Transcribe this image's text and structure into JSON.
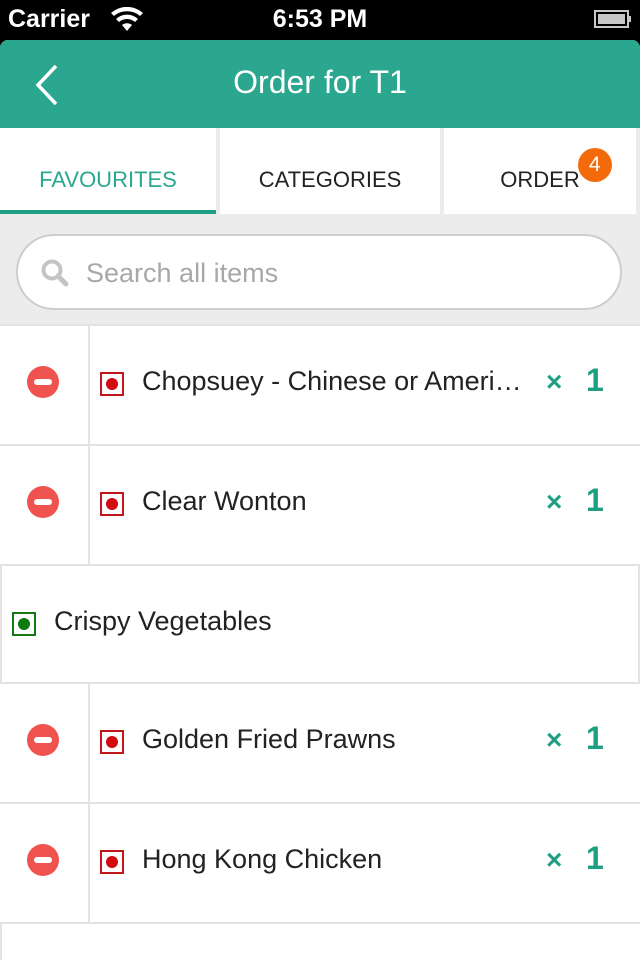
{
  "status_bar": {
    "carrier": "Carrier",
    "time": "6:53 PM",
    "wifi_icon": "wifi-icon",
    "battery_icon": "battery-icon"
  },
  "navbar": {
    "title": "Order for T1",
    "back_icon": "chevron-left-icon"
  },
  "tabs": [
    {
      "label": "FAVOURITES",
      "active": true
    },
    {
      "label": "CATEGORIES",
      "active": false
    },
    {
      "label": "ORDER",
      "active": false,
      "badge": "4"
    }
  ],
  "search": {
    "placeholder": "Search all items",
    "value": "",
    "icon": "search-icon"
  },
  "colors": {
    "accent": "#2aa78e",
    "badge": "#f36a0a",
    "remove": "#ef5350",
    "nonveg": "#d10a0f",
    "veg": "#0c7c0c"
  },
  "items": [
    {
      "name": "Chopsuey - Chinese or American",
      "display_name": "Chopsuey - Chinese or Ameri…",
      "type": "nonveg",
      "in_order": true,
      "times": "×",
      "qty": "1"
    },
    {
      "name": "Clear Wonton",
      "display_name": "Clear Wonton",
      "type": "nonveg",
      "in_order": true,
      "times": "×",
      "qty": "1"
    },
    {
      "name": "Crispy Vegetables",
      "display_name": "Crispy Vegetables",
      "type": "veg",
      "in_order": false
    },
    {
      "name": "Golden Fried Prawns",
      "display_name": "Golden Fried Prawns",
      "type": "nonveg",
      "in_order": true,
      "times": "×",
      "qty": "1"
    },
    {
      "name": "Hong Kong Chicken",
      "display_name": "Hong Kong Chicken",
      "type": "nonveg",
      "in_order": true,
      "times": "×",
      "qty": "1"
    }
  ]
}
